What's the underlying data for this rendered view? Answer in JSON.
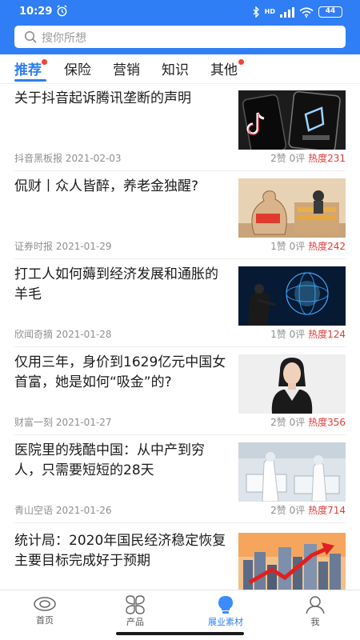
{
  "status_bar": {
    "time": "10:29",
    "network": "HD",
    "battery": "44"
  },
  "search": {
    "placeholder": "搜你所想"
  },
  "tabs": [
    {
      "label": "推荐",
      "active": true,
      "badge": true
    },
    {
      "label": "保险",
      "active": false,
      "badge": false
    },
    {
      "label": "营销",
      "active": false,
      "badge": false
    },
    {
      "label": "知识",
      "active": false,
      "badge": false
    },
    {
      "label": "其他",
      "active": false,
      "badge": true
    }
  ],
  "articles": [
    {
      "title": "关于抖音起诉腾讯垄断的声明",
      "source": "抖音黑板报 2021-02-03",
      "likes": "2赞",
      "comments": "0评",
      "heat": "热度231",
      "thumb": "tiktok-tencent-phones"
    },
    {
      "title": "侃财丨众人皆醉，养老金独醒?",
      "source": "证券时报 2021-01-29",
      "likes": "1赞",
      "comments": "0评",
      "heat": "热度242",
      "thumb": "pension-money-bag"
    },
    {
      "title": "打工人如何薅到经济发展和通胀的羊毛",
      "source": "欣闻奇摘 2021-01-28",
      "likes": "1赞",
      "comments": "0评",
      "heat": "热度124",
      "thumb": "businessman-digital-sphere"
    },
    {
      "title": "仅用三年，身价到1629亿元中国女首富，她是如何“吸金”的?",
      "source": "财富一刻 2021-01-27",
      "likes": "2赞",
      "comments": "0评",
      "heat": "热度356",
      "thumb": "woman-portrait"
    },
    {
      "title": "医院里的残酷中国：从中产到穷人，只需要短短的28天",
      "source": "青山空语 2021-01-26",
      "likes": "2赞",
      "comments": "0评",
      "heat": "热度714",
      "thumb": "hospital-ward"
    },
    {
      "title": "统计局：2020年国民经济稳定恢复 主要目标完成好于预期",
      "source": "",
      "likes": "",
      "comments": "",
      "heat": "",
      "thumb": "city-growth-arrow"
    }
  ],
  "bottom_nav": [
    {
      "label": "首页",
      "icon": "home-eye-icon",
      "active": false
    },
    {
      "label": "产品",
      "icon": "grid-petals-icon",
      "active": false
    },
    {
      "label": "展业素材",
      "icon": "lightbulb-icon",
      "active": true
    },
    {
      "label": "我",
      "icon": "person-icon",
      "active": false
    }
  ],
  "colors": {
    "brand_blue": "#2f7ef5",
    "heat_red": "#e53935",
    "badge_red": "#f44336"
  }
}
